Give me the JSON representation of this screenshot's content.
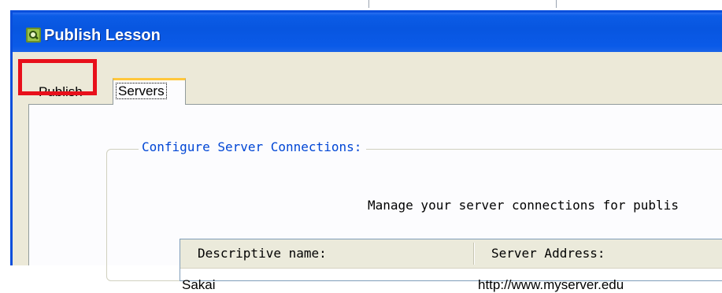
{
  "window": {
    "title": "Publish Lesson"
  },
  "tabs": [
    {
      "label": "Publish",
      "highlighted": true
    },
    {
      "label": "Servers",
      "active": true
    }
  ],
  "group": {
    "legend": "Configure Server Connections:",
    "description": "Manage your server connections for publis"
  },
  "server_list": {
    "columns": [
      "Descriptive name:",
      "Server Address:"
    ],
    "rows": [
      {
        "name": "Sakai",
        "address": "http://www.myserver.edu"
      }
    ]
  },
  "colors": {
    "titlebar": "#0856e0",
    "highlight": "#e8101b",
    "legend_text": "#0046d5",
    "active_tab_accent": "#ffc73c"
  }
}
